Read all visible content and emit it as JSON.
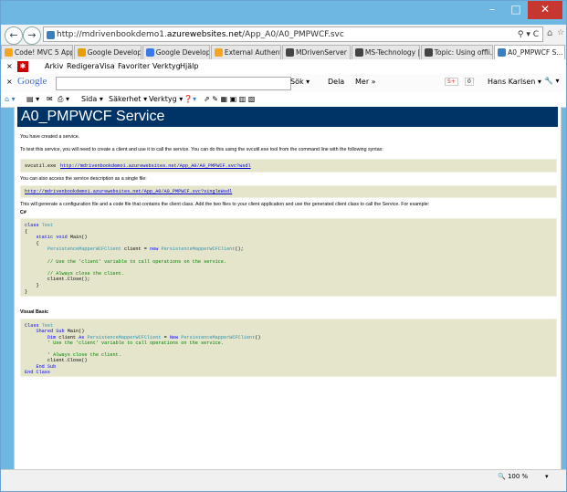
{
  "titlebar": {
    "minimize": "–",
    "maximize": "□",
    "close": "✕"
  },
  "address": {
    "prefix": "http://mdrivenbookdemo1.",
    "domain": "azurewebsites.net",
    "path": "/App_A0/A0_PMPWCF.svc",
    "search_icon": "⚲ ▾ C",
    "home": "⌂",
    "star": "☆",
    "gear": "⚙"
  },
  "tabs": [
    {
      "label": "Code! MVC 5 App...",
      "icon_color": "#f4a623"
    },
    {
      "label": "Google Developer...",
      "icon_color": "#e8a000"
    },
    {
      "label": "Google Developer...",
      "icon_color": "#3b78e7"
    },
    {
      "label": "External Authenti...",
      "icon_color": "#f4a623"
    },
    {
      "label": "MDrivenServer | C...",
      "icon_color": "#444"
    },
    {
      "label": "MS-Technology | ...",
      "icon_color": "#444"
    },
    {
      "label": "Topic: Using offli...",
      "icon_color": "#444"
    },
    {
      "label": "A0_PMPWCF S...",
      "icon_color": "#3a7fc1",
      "active": true,
      "close": "✕"
    }
  ],
  "menu": {
    "close_x": "×",
    "items": [
      "Arkiv",
      "Redigera",
      "Visa",
      "Favoriter",
      "Verktyg",
      "Hjälp"
    ]
  },
  "google": {
    "close_x": "×",
    "logo": "Google",
    "search_label": "Sök ▾",
    "share_label": "Dela",
    "more_label": "Mer »",
    "badge": "S+",
    "zero": "0",
    "user": "Hans Karlsen ▾",
    "tools": "🔧 ▾"
  },
  "commands": {
    "sida": "Sida ▾",
    "sakerhet": "Säkerhet ▾",
    "verktyg": "Verktyg ▾"
  },
  "page": {
    "title": "A0_PMPWCF Service",
    "created": "You have created a service.",
    "test_intro": "To test this service, you will need to create a client and use it to call the service. You can do this using the svcutil.exe tool from the command line with the following syntax:",
    "svcutil_cmd": "svcutil.exe",
    "wsdl_url": "http://mdrivenbookdemo1.azurewebsites.net/App_A0/A0_PMPWCF.svc?wsdl",
    "single_intro": "You can also access the service description as a single file:",
    "single_url": "http://mdrivenbookdemo1.azurewebsites.net/App_A0/A0_PMPWCF.svc?singleWsdl",
    "generate_text": "This will generate a configuration file and a code file that contains the client class. Add the two files to your client application and use the generated client class to call the Service. For example:",
    "csharp_label": "C#",
    "vb_label": "Visual Basic",
    "cs_lines": [
      "class Test",
      "{",
      "    static void Main()",
      "    {",
      "        PersistenceMapperWCFClient client = new PersistenceMapperWCFClient();",
      "",
      "        // Use the 'client' variable to call operations on the service.",
      "",
      "        // Always close the client.",
      "        client.Close();",
      "    }",
      "}"
    ],
    "vb_lines": [
      "Class Test",
      "    Shared Sub Main()",
      "        Dim client As PersistenceMapperWCFClient = New PersistenceMapperWCFClient()",
      "        ' Use the 'client' variable to call operations on the service.",
      "",
      "        ' Always close the client.",
      "        client.Close()",
      "    End Sub",
      "End Class"
    ]
  },
  "status": {
    "zoom": "🔍 100 %",
    "arrow": "▾"
  }
}
